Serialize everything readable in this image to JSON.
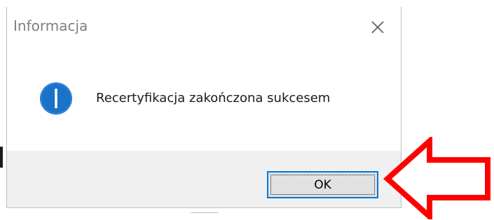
{
  "dialog": {
    "title": "Informacja",
    "close_icon": "close-icon",
    "icon": "info-icon",
    "message": "Recertyfikacja zakończona sukcesem",
    "ok_label": "OK"
  },
  "annotation": {
    "type": "arrow",
    "icon": "arrow-left-icon",
    "color": "#ff0000"
  },
  "colors": {
    "accent": "#0078d7",
    "info_icon": "#1a73c9",
    "button_area": "#f0f0f0"
  }
}
